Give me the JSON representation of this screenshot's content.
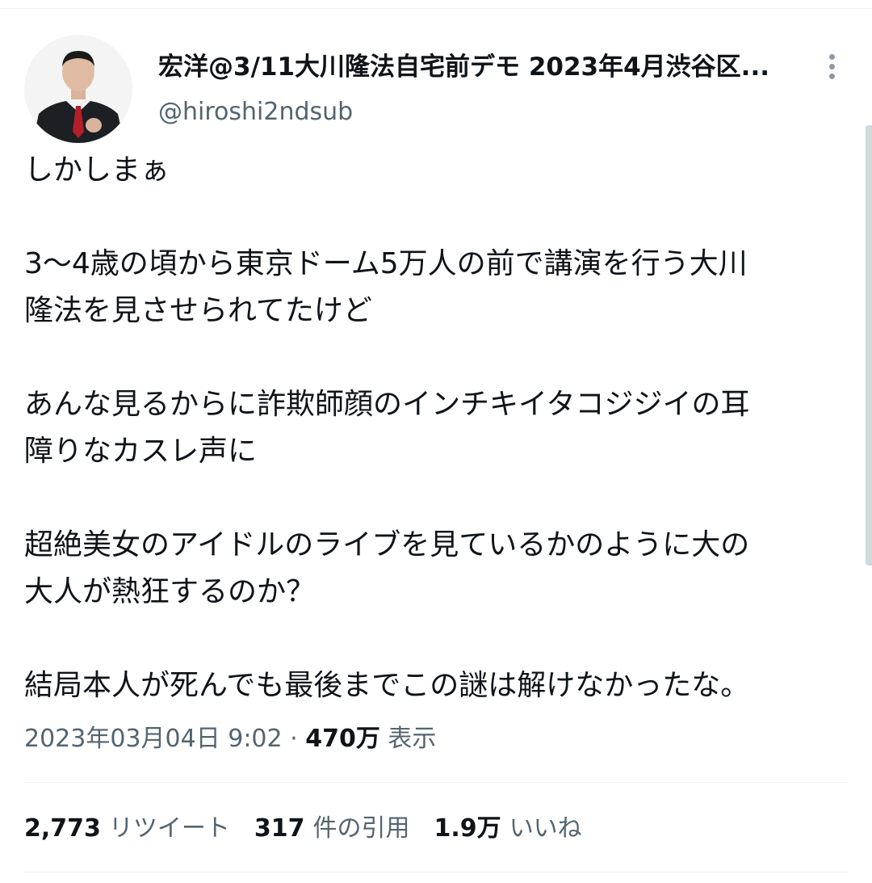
{
  "author": {
    "display_name": "宏洋@3/11大川隆法自宅前デモ 2023年4月渋谷区...",
    "handle": "@hiroshi2ndsub",
    "avatar_icon": "avatar-photo"
  },
  "tweet": {
    "paragraphs": [
      [
        "しかしまぁ"
      ],
      [
        "3〜4歳の頃から東京ドーム5万人の前で講演を行う大川",
        "隆法を見させられてたけど"
      ],
      [
        "あんな見るからに詐欺師顔のインチキイタコジジイの耳",
        "障りなカスレ声に"
      ],
      [
        "超絶美女のアイドルのライブを見ているかのように大の",
        "大人が熱狂するのか？"
      ],
      [
        "結局本人が死んでも最後までこの謎は解けなかったな。"
      ]
    ],
    "timestamp": "2023年03月04日 9:02",
    "separator": "·",
    "views_count": "470万",
    "views_label": "表示"
  },
  "stats": {
    "retweets": {
      "count": "2,773",
      "label": "リツイート"
    },
    "quotes": {
      "count": "317",
      "label": "件の引用"
    },
    "likes": {
      "count": "1.9万",
      "label": "いいね"
    }
  },
  "colors": {
    "text_primary": "#0f1419",
    "text_secondary": "#536471",
    "divider": "#eff3f4"
  }
}
